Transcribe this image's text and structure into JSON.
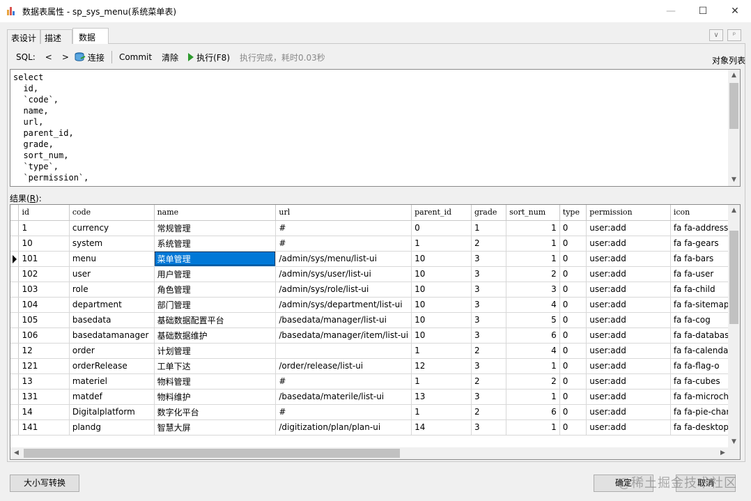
{
  "window": {
    "title": "数据表属性 - sp_sys_menu(系统菜单表)",
    "controls": {
      "minimize": "—",
      "maximize": "☐",
      "close": "✕"
    }
  },
  "tabs": [
    {
      "label": "表设计",
      "active": false
    },
    {
      "label": "描述",
      "active": false
    },
    {
      "label": "数据",
      "active": true
    }
  ],
  "tab_controls": {
    "collapse": "∨",
    "pin": "ᵖ"
  },
  "toolbar": {
    "sql_label": "SQL:",
    "back": "<",
    "forward": ">",
    "connect": "连接",
    "commit": "Commit",
    "clear": "清除",
    "execute": "执行(F8)",
    "status": "执行完成，耗时0.03秒",
    "object_list": "对象列表"
  },
  "sql_editor": {
    "text": "select\n  id,\n  `code`,\n  name,\n  url,\n  parent_id,\n  grade,\n  sort_num,\n  `type`,\n  `permission`,"
  },
  "results": {
    "label": "结果(",
    "label_key": "R",
    "label_end": "):",
    "columns": [
      "id",
      "code",
      "name",
      "url",
      "parent_id",
      "grade",
      "sort_num",
      "type",
      "permission",
      "icon"
    ],
    "current_row": 2,
    "selected_cell": {
      "row": 2,
      "col": 2
    },
    "rows": [
      [
        "1",
        "currency",
        "常规管理",
        "#",
        "0",
        "1",
        "1",
        "0",
        "user:add",
        "fa fa-address"
      ],
      [
        "10",
        "system",
        "系统管理",
        "#",
        "1",
        "2",
        "1",
        "0",
        "user:add",
        "fa fa-gears"
      ],
      [
        "101",
        "menu",
        "菜单管理",
        "/admin/sys/menu/list-ui",
        "10",
        "3",
        "1",
        "0",
        "user:add",
        "fa fa-bars"
      ],
      [
        "102",
        "user",
        "用户管理",
        "/admin/sys/user/list-ui",
        "10",
        "3",
        "2",
        "0",
        "user:add",
        "fa fa-user"
      ],
      [
        "103",
        "role",
        "角色管理",
        "/admin/sys/role/list-ui",
        "10",
        "3",
        "3",
        "0",
        "user:add",
        "fa fa-child"
      ],
      [
        "104",
        "department",
        "部门管理",
        "/admin/sys/department/list-ui",
        "10",
        "3",
        "4",
        "0",
        "user:add",
        "fa fa-sitemap"
      ],
      [
        "105",
        "basedata",
        "基础数据配置平台",
        "/basedata/manager/list-ui",
        "10",
        "3",
        "5",
        "0",
        "user:add",
        "fa fa-cog"
      ],
      [
        "106",
        "basedatamanager",
        "基础数据维护",
        "/basedata/manager/item/list-ui",
        "10",
        "3",
        "6",
        "0",
        "user:add",
        "fa fa-database"
      ],
      [
        "12",
        "order",
        "计划管理",
        "",
        "1",
        "2",
        "4",
        "0",
        "user:add",
        "fa fa-calendar"
      ],
      [
        "121",
        "orderRelease",
        "工单下达",
        "/order/release/list-ui",
        "12",
        "3",
        "1",
        "0",
        "user:add",
        "fa fa-flag-o"
      ],
      [
        "13",
        "materiel",
        "物料管理",
        "#",
        "1",
        "2",
        "2",
        "0",
        "user:add",
        "fa fa-cubes"
      ],
      [
        "131",
        "matdef",
        "物料维护",
        "/basedata/materile/list-ui",
        "13",
        "3",
        "1",
        "0",
        "user:add",
        "fa fa-microchip"
      ],
      [
        "14",
        "Digitalplatform",
        "数字化平台",
        "#",
        "1",
        "2",
        "6",
        "0",
        "user:add",
        "fa fa-pie-chart"
      ],
      [
        "141",
        "plandg",
        "智慧大屏",
        "/digitization/plan/plan-ui",
        "14",
        "3",
        "1",
        "0",
        "user:add",
        "fa fa-desktop"
      ]
    ]
  },
  "footer": {
    "case_convert": "大小写转换",
    "ok": "确定",
    "cancel": "取消"
  },
  "watermark": "@稀土掘金技术社区",
  "icons": {
    "app": "bar-chart-icon",
    "connect": "database-connect-icon",
    "execute": "play-icon",
    "current_row": "row-pointer-icon"
  },
  "colors": {
    "selection": "#0078d7",
    "execute_icon": "#2e9a2e"
  }
}
